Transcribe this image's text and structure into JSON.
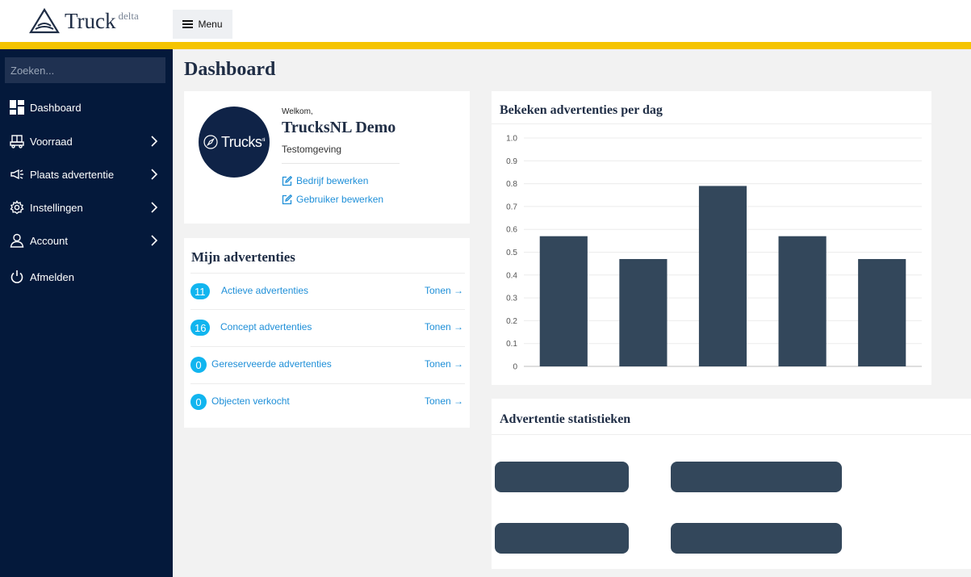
{
  "header": {
    "logo_text": "Truck",
    "logo_sup": "delta",
    "menu_label": "Menu"
  },
  "sidebar": {
    "search_placeholder": "Zoeken...",
    "items": [
      {
        "label": "Dashboard",
        "icon": "dashboard-icon",
        "has_submenu": false
      },
      {
        "label": "Voorraad",
        "icon": "truck-icon",
        "has_submenu": true
      },
      {
        "label": "Plaats advertentie",
        "icon": "megaphone-icon",
        "has_submenu": true
      },
      {
        "label": "Instellingen",
        "icon": "gear-icon",
        "has_submenu": true
      },
      {
        "label": "Account",
        "icon": "user-icon",
        "has_submenu": true
      },
      {
        "label": "Afmelden",
        "icon": "power-icon",
        "has_submenu": false
      }
    ]
  },
  "page": {
    "title": "Dashboard"
  },
  "welcome": {
    "greeting": "Welkom,",
    "company": "TrucksNL Demo",
    "environment": "Testomgeving",
    "avatar_text": "Trucks",
    "avatar_sup": "nl",
    "edit_company": "Bedrijf bewerken",
    "edit_user": "Gebruiker bewerken"
  },
  "ads": {
    "title": "Mijn advertenties",
    "rows": [
      {
        "count": "11",
        "label": "Actieve advertenties",
        "action": "Tonen →"
      },
      {
        "count": "16",
        "label": "Concept advertenties",
        "action": "Tonen →"
      },
      {
        "count": "0",
        "label": "Gereserveerde advertenties",
        "action": "Tonen →"
      },
      {
        "count": "0",
        "label": "Objecten verkocht",
        "action": "Tonen →"
      }
    ]
  },
  "stats": {
    "title": "Advertentie statistieken"
  },
  "colors": {
    "sidebar": "#04193b",
    "accent_stripe": "#f5c400",
    "badge": "#11b5ef",
    "link": "#1e8fd8",
    "bar": "#33475b"
  },
  "chart_data": {
    "type": "bar",
    "title": "Bekeken advertenties per dag",
    "categories": [
      "",
      "",
      "",
      "",
      ""
    ],
    "values": [
      0.57,
      0.47,
      0.79,
      0.57,
      0.47
    ],
    "ylim": [
      0,
      1.0
    ],
    "yticks": [
      "0",
      "0.1",
      "0.2",
      "0.3",
      "0.4",
      "0.5",
      "0.6",
      "0.7",
      "0.8",
      "0.9",
      "1.0"
    ],
    "grid": true,
    "legend": "none",
    "xlabel": "",
    "ylabel": ""
  }
}
